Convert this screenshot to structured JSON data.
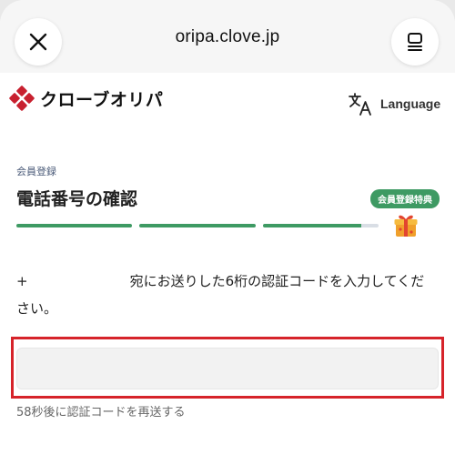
{
  "browser": {
    "url": "oripa.clove.jp"
  },
  "header": {
    "logo_text": "クローブオリパ",
    "language_label": "Language"
  },
  "main": {
    "breadcrumb": "会員登録",
    "title": "電話番号の確認",
    "progress": {
      "steps": 3,
      "completed_fraction": 0.85
    },
    "gift_badge": "会員登録特典",
    "instruction_prefix": "+",
    "instruction_text": "宛にお送りした6桁の認証コードを入力してください。",
    "code_input": {
      "value": "",
      "placeholder": ""
    },
    "resend_text": "58秒後に認証コードを再送する"
  },
  "colors": {
    "accent": "#3e9a63",
    "highlight": "#d6232a",
    "logo_red": "#c8202f"
  }
}
